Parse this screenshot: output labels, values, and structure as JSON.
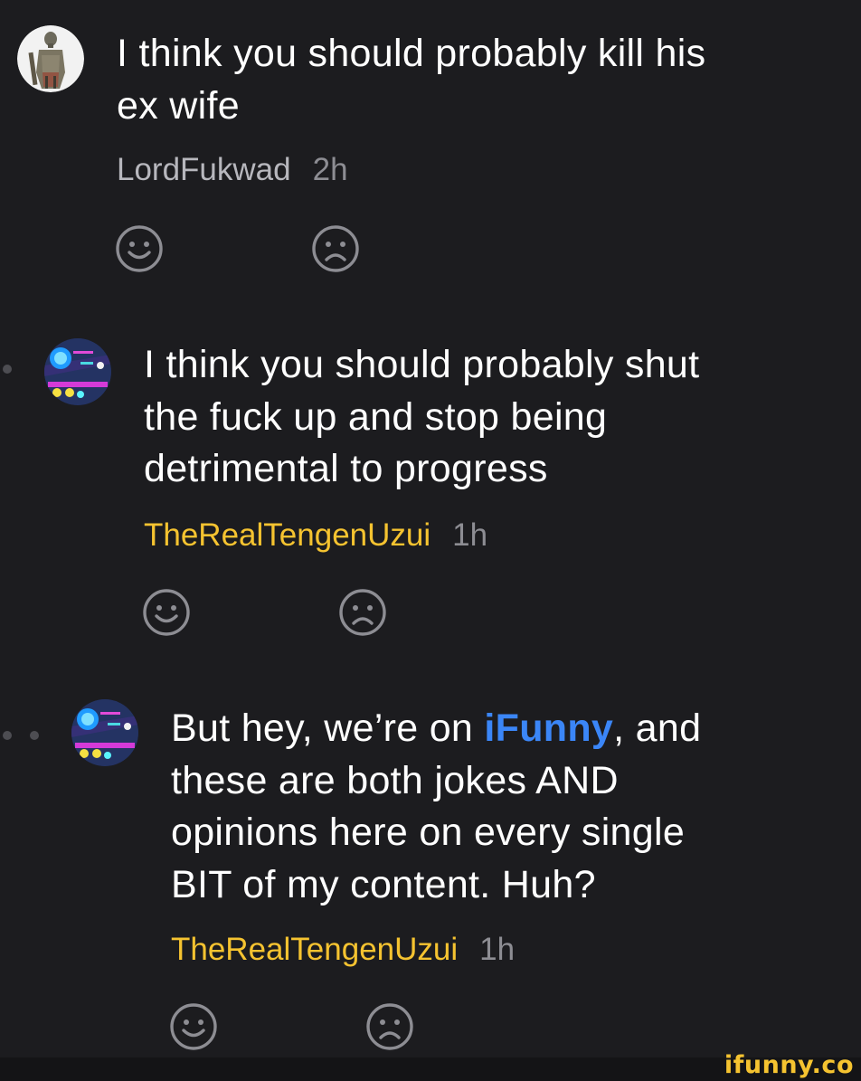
{
  "comments": [
    {
      "lines": [
        "I think you should probably kill his",
        "ex wife"
      ],
      "author": "LordFukwad",
      "time": "2h",
      "author_color": "#b7b7bd",
      "avatar_icon": "knight-avatar-icon"
    },
    {
      "lines": [
        "I think you should probably shut",
        "the fuck up and stop being",
        "detrimental to progress"
      ],
      "author": "TheRealTengenUzui",
      "time": "1h",
      "author_color": "#f5c330",
      "avatar_icon": "neon-game-avatar-icon"
    },
    {
      "line1_before": "But hey, we’re on ",
      "line1_highlight": "iFunny",
      "line1_after": ", and",
      "lines_rest": [
        "these are both jokes AND",
        "opinions here on every single",
        "BIT of my content. Huh?"
      ],
      "author": "TheRealTengenUzui",
      "time": "1h",
      "author_color": "#f5c330",
      "avatar_icon": "neon-game-avatar-icon"
    }
  ],
  "reactions": {
    "smile_icon": "smile-icon",
    "frown_icon": "frown-icon"
  },
  "colors": {
    "background": "#1c1c1f",
    "text": "#ffffff",
    "highlight": "#3b86f7",
    "gold": "#f5c330",
    "muted": "#8d8d93"
  },
  "watermark": "ifunny.co"
}
